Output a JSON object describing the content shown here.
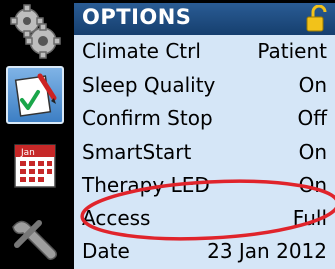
{
  "header": {
    "title": "OPTIONS"
  },
  "rail": {
    "icons": [
      "gears-icon",
      "checklist-icon",
      "calendar-icon",
      "tools-icon"
    ],
    "calendar_label": "Jan"
  },
  "options": [
    {
      "label": "Climate Ctrl",
      "value": "Patient"
    },
    {
      "label": "Sleep Quality",
      "value": "On"
    },
    {
      "label": "Confirm Stop",
      "value": "Off"
    },
    {
      "label": "SmartStart",
      "value": "On"
    },
    {
      "label": "Therapy LED",
      "value": "On"
    },
    {
      "label": "Access",
      "value": "Full"
    },
    {
      "label": "Date",
      "value": "23 Jan 2012"
    }
  ],
  "colors": {
    "header_bg": "#1f4e84",
    "list_bg": "#d5e6f7",
    "highlight_ring": "#e0242b",
    "selected_icon_bg": "#5a97d6"
  }
}
